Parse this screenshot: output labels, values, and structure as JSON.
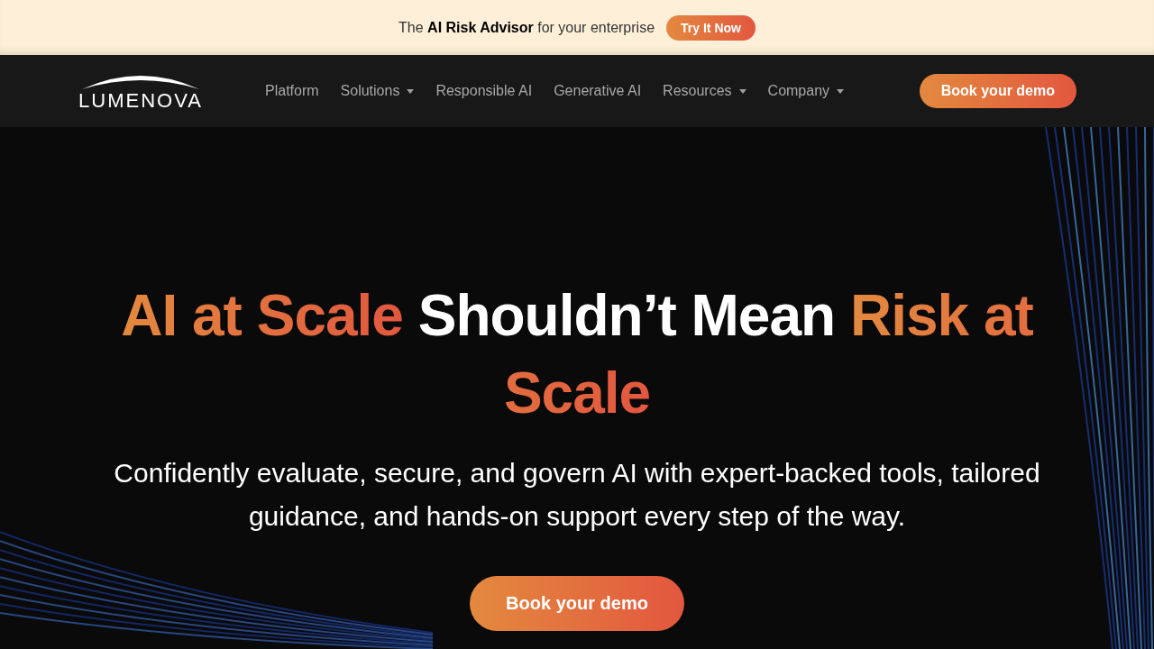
{
  "announcement": {
    "text": "The **AI Risk Advisor** for your enterprise",
    "button": "Try It Now"
  },
  "navbar": {
    "logo": "LUMENOVA",
    "items": [
      {
        "label": "Platform",
        "dropdown": false
      },
      {
        "label": "Solutions",
        "dropdown": true
      },
      {
        "label": "Responsible AI",
        "dropdown": false
      },
      {
        "label": "Generative AI",
        "dropdown": false
      },
      {
        "label": "Resources",
        "dropdown": true
      },
      {
        "label": "Company",
        "dropdown": true
      }
    ],
    "cta": "Book your demo"
  },
  "hero": {
    "headline": [
      {
        "text": "AI at Scale",
        "accent": true
      },
      {
        "text": "Shouldn’t Mean",
        "accent": false
      },
      {
        "text": "Risk at Scale",
        "accent": true
      }
    ],
    "subtitle": "Confidently evaluate, secure, and govern AI with expert-backed tools, tailored guidance, and hands-on support every step of the way.",
    "button": "Book your demo"
  }
}
